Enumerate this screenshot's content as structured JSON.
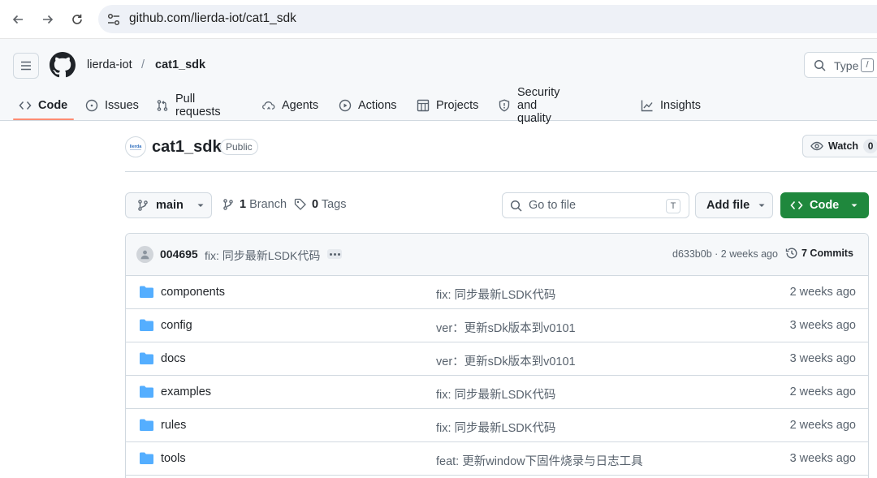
{
  "browser": {
    "url": "github.com/lierda-iot/cat1_sdk",
    "back_icon": "arrow-left-icon",
    "forward_icon": "arrow-right-icon",
    "reload_icon": "reload-icon",
    "site_info_icon": "tune-icon"
  },
  "header": {
    "owner": "lierda-iot",
    "separator": "/",
    "repo": "cat1_sdk",
    "search_label": "Type",
    "search_shortcut": "/"
  },
  "tabs": [
    {
      "label": "Code",
      "icon": "code-icon",
      "active": true
    },
    {
      "label": "Issues",
      "icon": "issue-icon"
    },
    {
      "label": "Pull requests",
      "icon": "pull-request-icon"
    },
    {
      "label": "Agents",
      "icon": "agents-icon"
    },
    {
      "label": "Actions",
      "icon": "play-icon"
    },
    {
      "label": "Projects",
      "icon": "table-icon"
    },
    {
      "label": "Security and quality",
      "icon": "shield-icon"
    },
    {
      "label": "Insights",
      "icon": "graph-icon"
    }
  ],
  "repo": {
    "name": "cat1_sdk",
    "visibility": "Public",
    "avatar_text": "lierda",
    "watch_label": "Watch",
    "watch_count": "0"
  },
  "toolbar": {
    "branch": "main",
    "branch_count": "1",
    "branch_label": "Branch",
    "tag_count": "0",
    "tag_label": "Tags",
    "goto_placeholder": "Go to file",
    "goto_shortcut": "T",
    "add_file": "Add file",
    "code": "Code"
  },
  "latest_commit": {
    "author": "004695",
    "message": "fix: 同步最新LSDK代码",
    "sha_time": "d633b0b · 2 weeks ago",
    "commits": "7 Commits"
  },
  "files": [
    {
      "name": "components",
      "message": "fix: 同步最新LSDK代码",
      "age": "2 weeks ago"
    },
    {
      "name": "config",
      "message": "ver：更新sDk版本到v0101",
      "age": "3 weeks ago"
    },
    {
      "name": "docs",
      "message": "ver：更新sDk版本到v0101",
      "age": "3 weeks ago"
    },
    {
      "name": "examples",
      "message": "fix: 同步最新LSDK代码",
      "age": "2 weeks ago"
    },
    {
      "name": "rules",
      "message": "fix: 同步最新LSDK代码",
      "age": "2 weeks ago"
    },
    {
      "name": "tools",
      "message": "feat: 更新window下固件烧录与日志工具",
      "age": "3 weeks ago"
    }
  ],
  "colors": {
    "accent_underline": "#fd8c73",
    "code_button": "#1f883d",
    "folder": "#54aeff"
  }
}
